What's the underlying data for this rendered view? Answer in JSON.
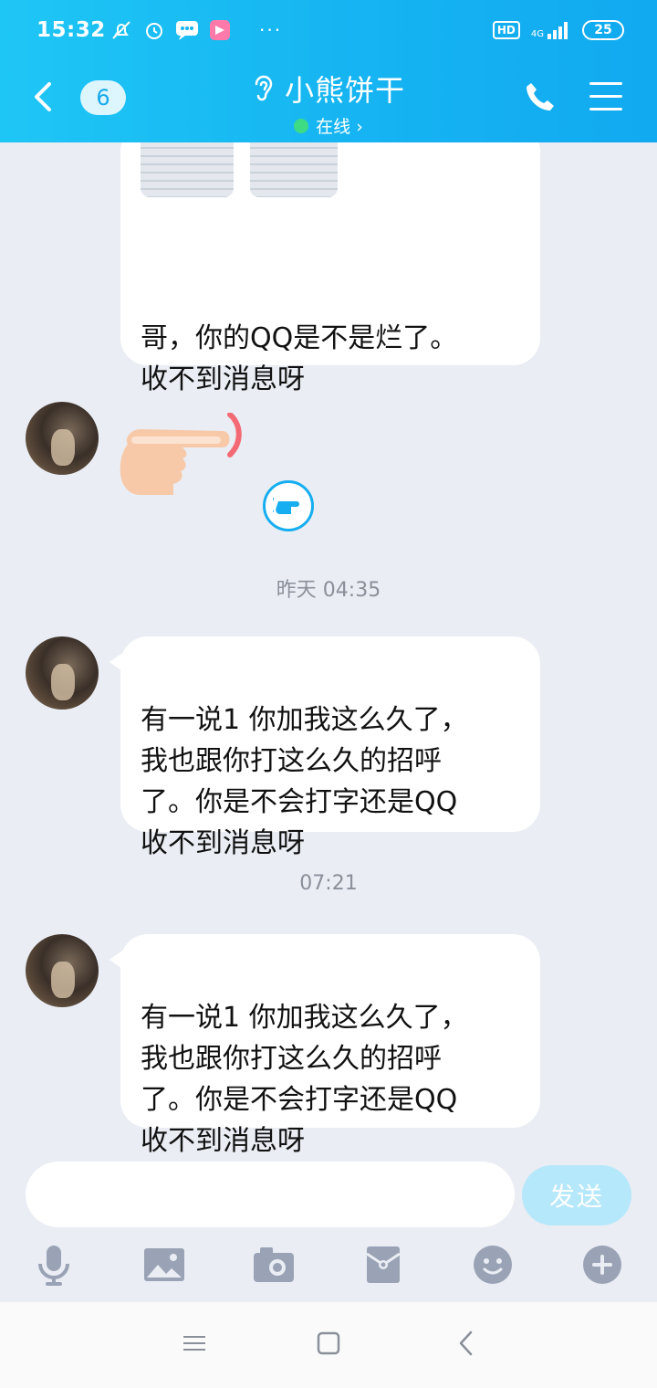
{
  "status_bar": {
    "time": "15:32",
    "dots": "···",
    "hd_label": "HD",
    "network_label": "4G",
    "battery": "25"
  },
  "header": {
    "unread_count": "6",
    "contact_name": "小熊饼干",
    "presence": "在线 ›",
    "icons": [
      "back-arrow-icon",
      "ear-icon",
      "phone-icon",
      "menu-icon"
    ]
  },
  "messages": [
    {
      "type": "text",
      "text": "哥，你的QQ是不是烂了。\n收不到消息呀"
    },
    {
      "type": "sticker",
      "description": "pointing-hand-sticker"
    },
    {
      "type": "timestamp",
      "text": "昨天 04:35"
    },
    {
      "type": "text",
      "text": "有一说1  你加我这么久了，\n我也跟你打这么久的招呼\n了。你是不会打字还是QQ\n收不到消息呀"
    },
    {
      "type": "timestamp",
      "text": "07:21"
    },
    {
      "type": "text",
      "text": "有一说1  你加我这么久了，\n我也跟你打这么久的招呼\n了。你是不会打字还是QQ\n收不到消息呀"
    }
  ],
  "composer": {
    "value": "",
    "placeholder": "",
    "send_label": "发送",
    "tools": [
      "microphone-icon",
      "image-icon",
      "camera-icon",
      "red-packet-icon",
      "emoji-icon",
      "plus-icon"
    ]
  },
  "colors": {
    "header": "#16b4f2",
    "background": "#eaedf4",
    "send_button": "#b6e8fb",
    "tool_icons": "#9aa3b5",
    "online_dot": "#3ddc84"
  }
}
